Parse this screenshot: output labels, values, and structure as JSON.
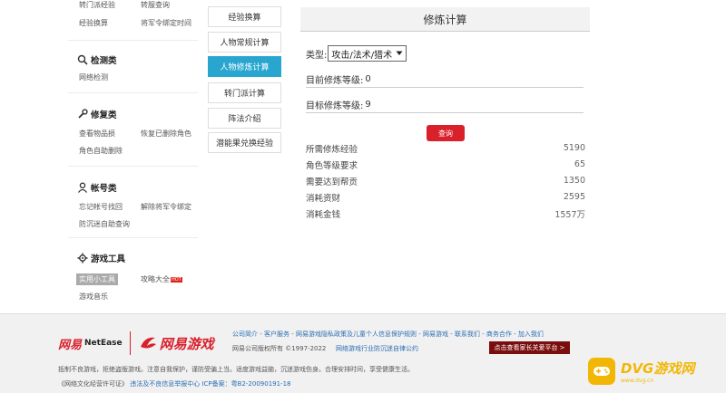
{
  "sidebar": {
    "top_links": [
      "转门派经验",
      "转服查询",
      "经验换算",
      "将军令绑定时间"
    ],
    "sections": [
      {
        "title": "检测类",
        "icon": "magnifier-icon",
        "links": [
          "网络检测"
        ]
      },
      {
        "title": "修复类",
        "icon": "wrench-icon",
        "links": [
          "查看物品损",
          "恢复已删除角色",
          "角色自助删除"
        ]
      },
      {
        "title": "帐号类",
        "icon": "user-icon",
        "links": [
          "忘记帐号找回",
          "解除将军令绑定",
          "防沉迷自助查询"
        ]
      },
      {
        "title": "游戏工具",
        "icon": "gear-icon",
        "links": [
          "实用小工具",
          "攻略大全",
          "游戏音乐"
        ],
        "hot_label": "HOT"
      }
    ]
  },
  "menu": [
    {
      "label": "经验换算",
      "active": false
    },
    {
      "label": "人物常规计算",
      "active": false
    },
    {
      "label": "人物修炼计算",
      "active": true
    },
    {
      "label": "转门派计算",
      "active": false
    },
    {
      "label": "阵法介绍",
      "active": false
    },
    {
      "label": "潜能果兑换经验",
      "active": false
    }
  ],
  "calc": {
    "title": "修炼计算",
    "type_label": "类型:",
    "type_value": "攻击/法术/猎术",
    "current_label": "目前修炼等级:",
    "current_value": "0",
    "target_label": "目标修炼等级:",
    "target_value": "9",
    "query_label": "查询",
    "results": [
      {
        "label": "所需修炼经验",
        "value": "5190"
      },
      {
        "label": "角色等级要求",
        "value": "65"
      },
      {
        "label": "需要达到帮贡",
        "value": "1350"
      },
      {
        "label": "消耗资财",
        "value": "2595"
      },
      {
        "label": "消耗金钱",
        "value": "1557万"
      }
    ]
  },
  "footer": {
    "logo_163": "网易",
    "logo_netease": "NetEase",
    "logo_game": "网易游戏",
    "links": [
      "公司简介",
      "客户服务",
      "网易游戏隐私政策及儿童个人信息保护规则",
      "网易游戏",
      "联系我们",
      "商务合作",
      "加入我们"
    ],
    "copyright": "网易公司版权所有 ©1997-2022",
    "self_regulation": "网络游戏行业防沉迷自律公约",
    "parent_button": "点击查看家长关爱平台 >",
    "notice": "抵制不良游戏，拒绝盗版游戏。注意自我保护，谨防受骗上当。适度游戏益脑，沉迷游戏伤身。合理安排时间，享受健康生活。",
    "license_prefix": "《网络文化经营许可证》",
    "report_center": "违法及不良信息举报中心",
    "icp": "ICP备案：粤B2-20090191-18"
  },
  "watermark": {
    "main": "DVG游戏网",
    "sub": "www.dvg.cn"
  },
  "colors": {
    "accent_blue": "#28a6cf",
    "query_red": "#d9202b",
    "watermark_yellow": "#f2b705"
  }
}
